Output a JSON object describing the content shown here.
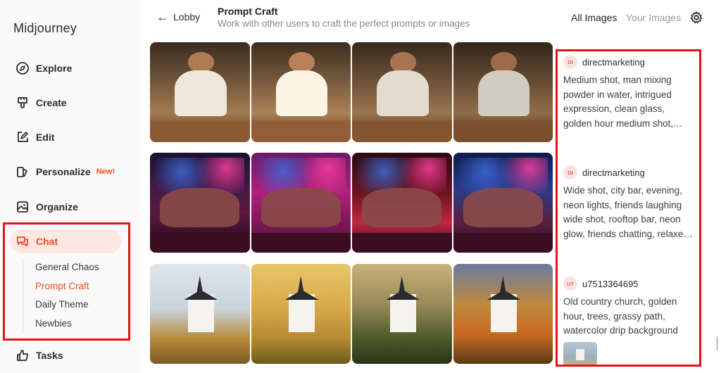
{
  "sidebar": {
    "logo": "Midjourney",
    "items": [
      {
        "label": "Explore",
        "icon": "compass-icon"
      },
      {
        "label": "Create",
        "icon": "brush-icon"
      },
      {
        "label": "Edit",
        "icon": "edit-icon"
      },
      {
        "label": "Personalize",
        "icon": "personalize-icon",
        "badge": "New!"
      },
      {
        "label": "Organize",
        "icon": "image-icon"
      },
      {
        "label": "Chat",
        "icon": "chat-icon",
        "active": true
      },
      {
        "label": "Tasks",
        "icon": "thumbs-up-icon"
      }
    ],
    "chat_rooms": [
      "General Chaos",
      "Prompt Craft",
      "Daily Theme",
      "Newbies"
    ],
    "active_room": "Prompt Craft"
  },
  "header": {
    "back_label": "Lobby",
    "title": "Prompt Craft",
    "subtitle": "Work with other users to craft the perfect prompts or images",
    "tab_all": "All Images",
    "tab_yours": "Your Images",
    "active_tab": "All Images"
  },
  "prompts": [
    {
      "avatar": "DI",
      "user": "directmarketing",
      "text": "Medium shot, man mixing powder in water, intrigued expression, clean glass, golden hour medium shot,…"
    },
    {
      "avatar": "DI",
      "user": "directmarketing",
      "text": "Wide shot, city bar, evening, neon lights, friends laughing wide shot, rooftop bar, neon glow, friends chatting, relaxe…"
    },
    {
      "avatar": "U7",
      "user": "u7513364695",
      "text": "Old country church, golden hour, trees, grassy path, watercolor drip background"
    }
  ],
  "colors": {
    "accent": "#ef4a23",
    "active_bg": "#ffe8e2",
    "highlight_box": "#e3131b",
    "subtitle": "#8a8a8a"
  }
}
